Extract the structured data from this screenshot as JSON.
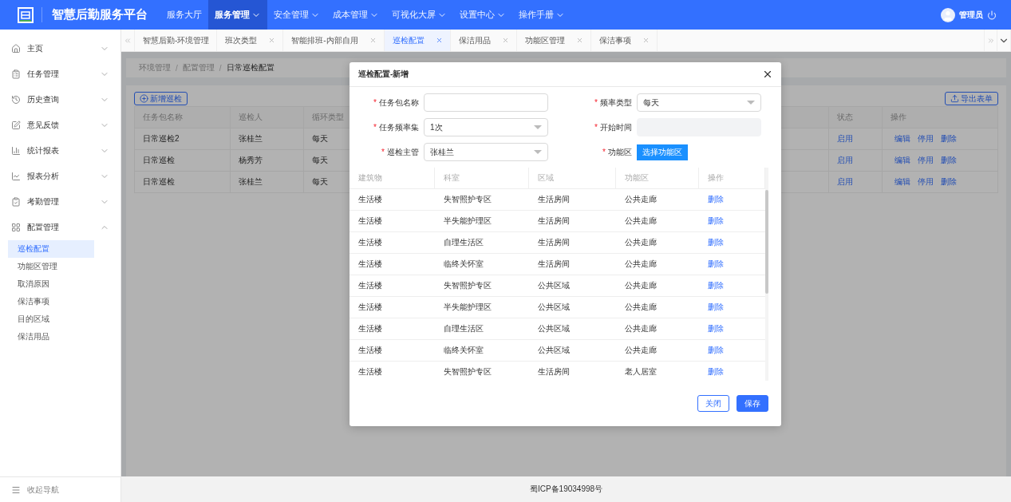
{
  "header": {
    "logo_title": "智慧后勤服务平台",
    "nav": [
      {
        "label": "服务大厅",
        "selected": false,
        "dropdown": false
      },
      {
        "label": "服务管理",
        "selected": true,
        "dropdown": true
      },
      {
        "label": "安全管理",
        "selected": false,
        "dropdown": true
      },
      {
        "label": "成本管理",
        "selected": false,
        "dropdown": true
      },
      {
        "label": "可视化大屏",
        "selected": false,
        "dropdown": true
      },
      {
        "label": "设置中心",
        "selected": false,
        "dropdown": true
      },
      {
        "label": "操作手册",
        "selected": false,
        "dropdown": true
      }
    ],
    "user": "管理员"
  },
  "sidebar": {
    "items": [
      {
        "label": "主页",
        "expanded": false
      },
      {
        "label": "任务管理",
        "expanded": false
      },
      {
        "label": "历史查询",
        "expanded": false
      },
      {
        "label": "意见反馈",
        "expanded": false
      },
      {
        "label": "统计报表",
        "expanded": false
      },
      {
        "label": "报表分析",
        "expanded": false
      },
      {
        "label": "考勤管理",
        "expanded": false
      },
      {
        "label": "配置管理",
        "expanded": true,
        "children": [
          {
            "label": "巡检配置",
            "selected": true
          },
          {
            "label": "功能区管理",
            "selected": false
          },
          {
            "label": "取消原因",
            "selected": false
          },
          {
            "label": "保洁事项",
            "selected": false
          },
          {
            "label": "目的区域",
            "selected": false
          },
          {
            "label": "保洁用品",
            "selected": false
          }
        ]
      }
    ],
    "collapse": "收起导航"
  },
  "tabs": [
    {
      "label": "智慧后勤-环境管理",
      "selected": false,
      "closable": false
    },
    {
      "label": "班次类型",
      "selected": false,
      "closable": true
    },
    {
      "label": "智能排班-内部自用",
      "selected": false,
      "closable": true
    },
    {
      "label": "巡检配置",
      "selected": true,
      "closable": true
    },
    {
      "label": "保洁用品",
      "selected": false,
      "closable": true
    },
    {
      "label": "功能区管理",
      "selected": false,
      "closable": true
    },
    {
      "label": "保洁事项",
      "selected": false,
      "closable": true
    }
  ],
  "breadcrumb": [
    {
      "kind": "link",
      "text": "环境管理"
    },
    {
      "kind": "separator",
      "text": "/"
    },
    {
      "kind": "link",
      "text": "配置管理"
    },
    {
      "kind": "separator",
      "text": "/"
    },
    {
      "kind": "current",
      "text": "日常巡检配置"
    }
  ],
  "toolbar": {
    "add_button": "新增巡检",
    "export_button": "导出表单"
  },
  "table": {
    "columns": [
      "任务包名称",
      "巡检人",
      "循环类型",
      "状态",
      "操作"
    ],
    "rows": [
      {
        "name": "日常巡检2",
        "inspector": "张桂兰",
        "cycle": "每天",
        "status": "启用",
        "actions": [
          "编辑",
          "停用",
          "删除"
        ]
      },
      {
        "name": "日常巡检",
        "inspector": "杨秀芳",
        "cycle": "每天",
        "status": "启用",
        "actions": [
          "编辑",
          "停用",
          "删除"
        ]
      },
      {
        "name": "日常巡检",
        "inspector": "张桂兰",
        "cycle": "每天",
        "status": "启用",
        "actions": [
          "编辑",
          "停用",
          "删除"
        ]
      }
    ]
  },
  "dialog": {
    "title": "巡检配置-新增",
    "fields": [
      {
        "label": "任务包名称",
        "kind": "text",
        "required_mark": "*"
      },
      {
        "label": "频率类型",
        "kind": "select",
        "required_mark": "*",
        "value": "每天"
      },
      {
        "label": "任务频率集",
        "kind": "select",
        "required_mark": "*",
        "value": "1次"
      },
      {
        "label": "开始时间",
        "kind": "readonly",
        "required_mark": "*"
      },
      {
        "label": "巡检主管",
        "kind": "select",
        "required_mark": "*",
        "value": "张桂兰"
      },
      {
        "label": "功能区",
        "kind": "button",
        "required_mark": "*",
        "button_label": "选择功能区"
      }
    ],
    "table": {
      "columns": [
        "建筑物",
        "科室",
        "区域",
        "功能区",
        "操作"
      ],
      "rows": [
        [
          "生活楼",
          "失智照护专区",
          "生活房间",
          "公共走廊",
          "删除"
        ],
        [
          "生活楼",
          "半失能护理区",
          "生活房间",
          "公共走廊",
          "删除"
        ],
        [
          "生活楼",
          "自理生活区",
          "生活房间",
          "公共走廊",
          "删除"
        ],
        [
          "生活楼",
          "临终关怀室",
          "生活房间",
          "公共走廊",
          "删除"
        ],
        [
          "生活楼",
          "失智照护专区",
          "公共区域",
          "公共走廊",
          "删除"
        ],
        [
          "生活楼",
          "半失能护理区",
          "公共区域",
          "公共走廊",
          "删除"
        ],
        [
          "生活楼",
          "自理生活区",
          "公共区域",
          "公共走廊",
          "删除"
        ],
        [
          "生活楼",
          "临终关怀室",
          "公共区域",
          "公共走廊",
          "删除"
        ],
        [
          "生活楼",
          "失智照护专区",
          "生活房间",
          "老人居室",
          "删除"
        ]
      ]
    },
    "buttons": [
      {
        "label": "关闭",
        "kind": "secondary"
      },
      {
        "label": "保存",
        "kind": "primary"
      }
    ]
  },
  "footer": "蜀ICP备19034998号"
}
